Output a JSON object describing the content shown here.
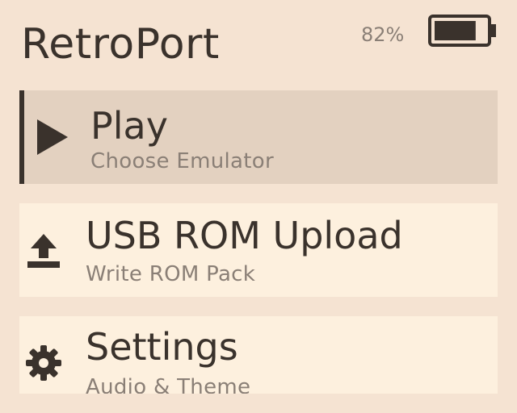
{
  "header": {
    "app_title": "RetroPort",
    "battery_percent_label": "82%",
    "battery_level": 0.82
  },
  "menu": {
    "items": [
      {
        "label": "Play",
        "subtitle": "Choose Emulator",
        "icon": "play-icon",
        "selected": true
      },
      {
        "label": "USB ROM Upload",
        "subtitle": "Write ROM Pack",
        "icon": "upload-icon",
        "selected": false
      },
      {
        "label": "Settings",
        "subtitle": "Audio & Theme",
        "icon": "gear-icon",
        "selected": false
      }
    ]
  },
  "colors": {
    "background": "#f5e3d2",
    "item_background": "#fdf0de",
    "selected_background": "#e3d1c0",
    "text": "#3a322c",
    "subtext": "#8a7f76"
  }
}
